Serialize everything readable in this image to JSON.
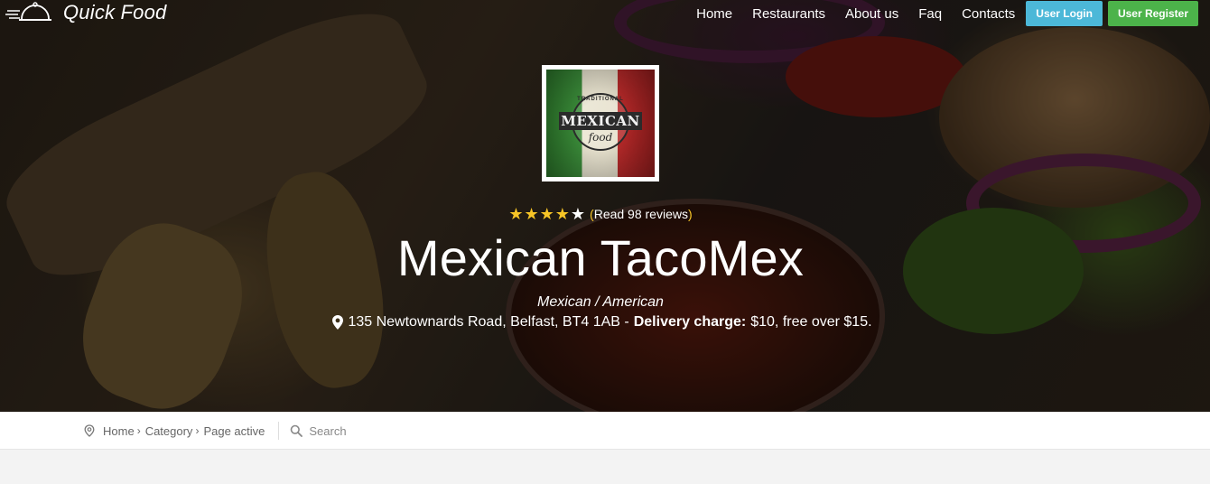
{
  "header": {
    "logo_text": "Quick Food",
    "nav": [
      "Home",
      "Restaurants",
      "About us",
      "Faq",
      "Contacts"
    ],
    "login_label": "User Login",
    "register_label": "User Register"
  },
  "restaurant": {
    "logo_lettering": {
      "top": "TRADITIONAL",
      "main": "MEXICAN",
      "script": "food"
    },
    "rating": 4,
    "rating_max": 5,
    "reviews_link": "Read 98 reviews",
    "name": "Mexican TacoMex",
    "cuisine": "Mexican / American",
    "address": "135 Newtownards Road, Belfast, BT4 1AB -",
    "delivery_label": "Delivery charge:",
    "delivery_text": "$10, free over $15."
  },
  "breadcrumb": {
    "items": [
      "Home",
      "Category",
      "Page active"
    ],
    "search_placeholder": "Search"
  },
  "icons": {
    "logo": "cloche-icon",
    "location": "map-pin-icon",
    "search": "search-icon"
  },
  "colors": {
    "login": "#4cb8d8",
    "register": "#4cb34a",
    "star": "#f7c526"
  }
}
